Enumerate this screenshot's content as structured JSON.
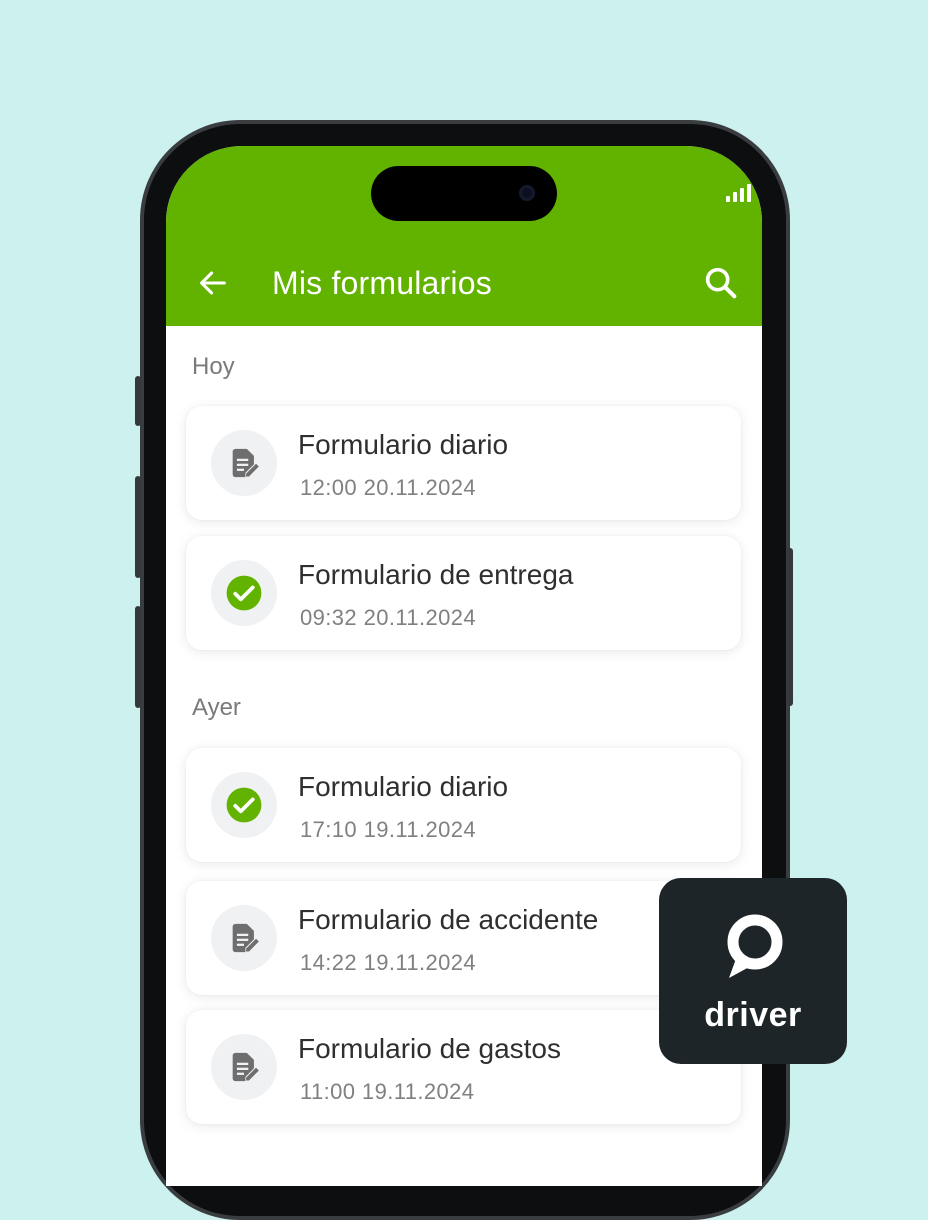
{
  "app": {
    "title": "Mis formularios",
    "accent_color": "#62b300",
    "back_icon": "arrow-left-icon",
    "search_icon": "search-icon"
  },
  "sections": [
    {
      "label": "Hoy",
      "items": [
        {
          "title": "Formulario diario",
          "time": "12:00 20.11.2024",
          "status": "pending",
          "icon": "document-edit-icon"
        },
        {
          "title": "Formulario de entrega",
          "time": "09:32 20.11.2024",
          "status": "completed",
          "icon": "check-circle-icon"
        }
      ]
    },
    {
      "label": "Ayer",
      "items": [
        {
          "title": "Formulario diario",
          "time": "17:10 19.11.2024",
          "status": "completed",
          "icon": "check-circle-icon"
        },
        {
          "title": "Formulario de accidente",
          "time": "14:22 19.11.2024",
          "status": "pending",
          "icon": "document-edit-icon"
        },
        {
          "title": "Formulario de gastos",
          "time": "11:00 19.11.2024",
          "status": "pending",
          "icon": "document-edit-icon"
        }
      ]
    }
  ],
  "brand_badge": {
    "label": "driver",
    "background": "#1e2528",
    "icon": "location-pin-icon"
  }
}
